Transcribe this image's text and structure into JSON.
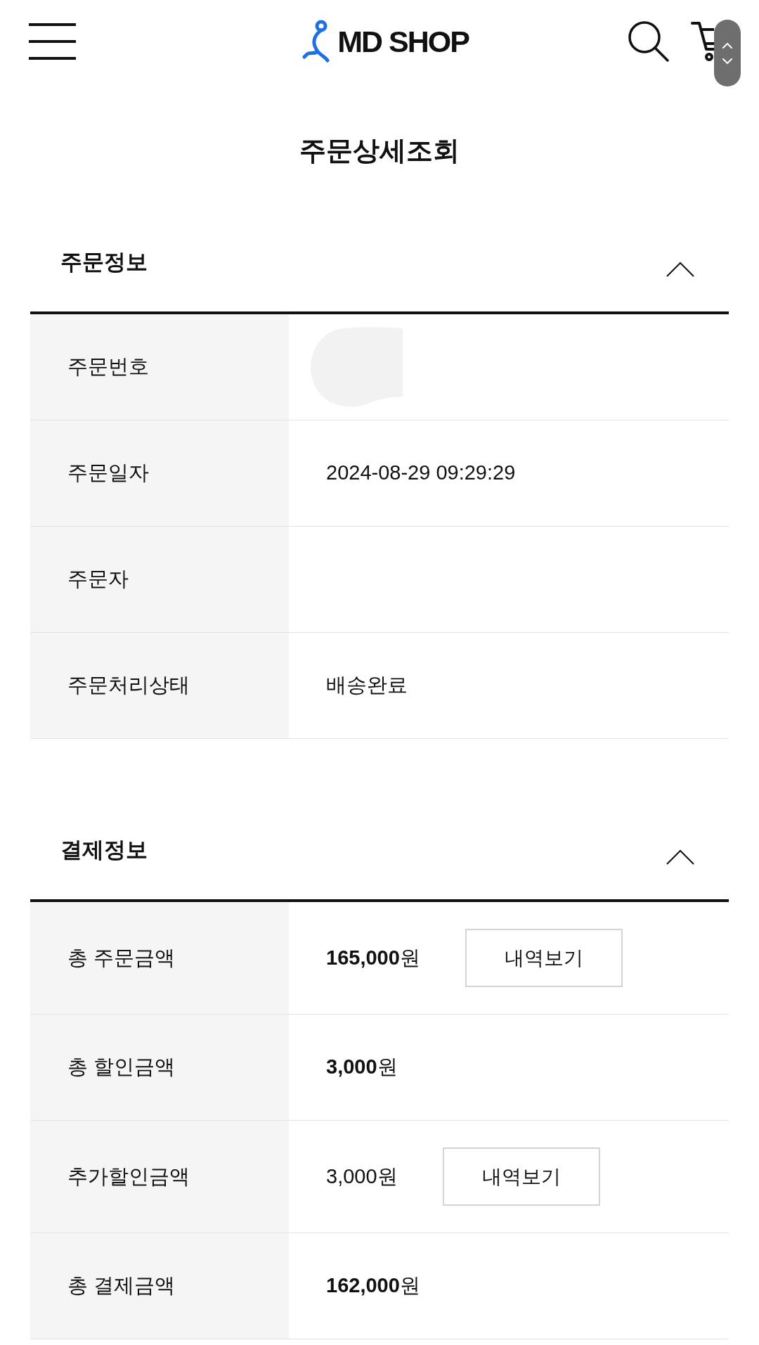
{
  "header": {
    "logo_text": "MD SHOP"
  },
  "page_title": "주문상세조회",
  "sections": [
    {
      "title": "주문정보",
      "expanded": true,
      "rows": [
        {
          "label": "주문번호",
          "kind": "redacted"
        },
        {
          "label": "주문일자",
          "kind": "text",
          "value": "2024-08-29 09:29:29"
        },
        {
          "label": "주문자",
          "kind": "text"
        },
        {
          "label": "주문처리상태",
          "kind": "text",
          "value": "배송완료"
        }
      ]
    },
    {
      "title": "결제정보",
      "expanded": true,
      "rows": [
        {
          "label": "총 주문금액",
          "kind": "text",
          "value": "**165,000**원",
          "button": "내역보기"
        },
        {
          "label": "총 할인금액",
          "kind": "text",
          "value": "**3,000**원"
        },
        {
          "label": "추가할인금액",
          "kind": "text",
          "value": "3,000원",
          "button": "내역보기"
        },
        {
          "label": "총 결제금액",
          "kind": "text",
          "value": "**162,000**원"
        }
      ]
    }
  ]
}
